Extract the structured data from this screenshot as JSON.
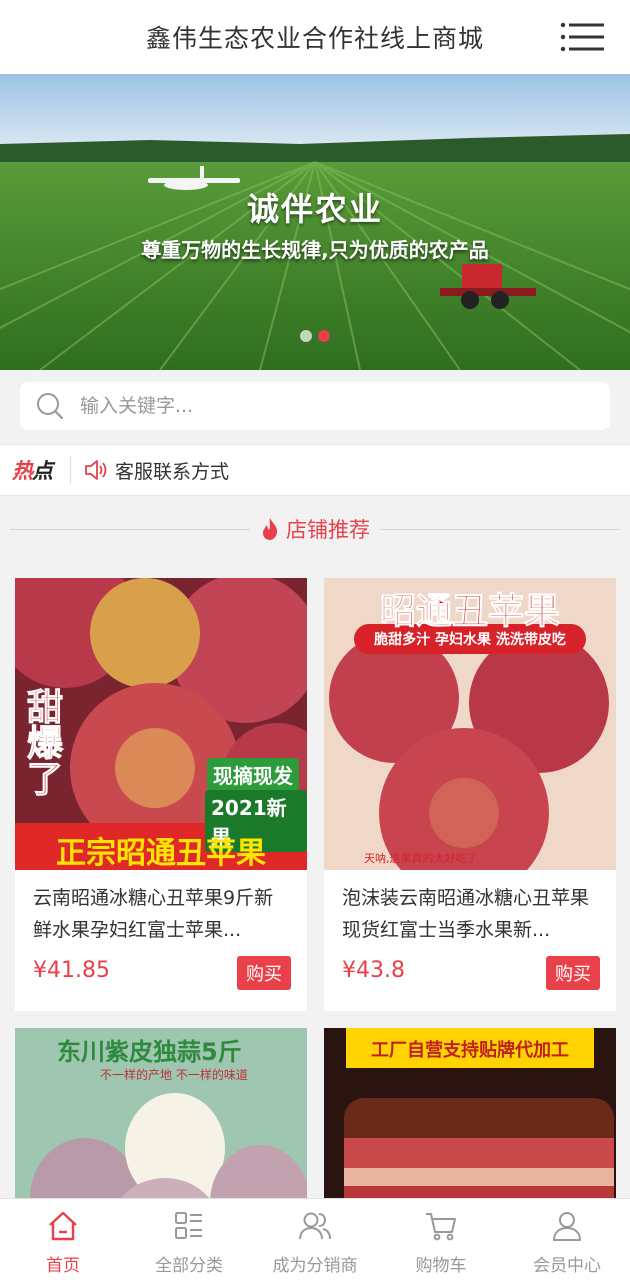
{
  "header": {
    "title": "鑫伟生态农业合作社线上商城",
    "menu_icon": "menu-icon"
  },
  "banner": {
    "headline": "诚伴农业",
    "subline": "尊重万物的生长规律,只为优质的农产品",
    "slide_count": 2,
    "active_slide": 2
  },
  "search": {
    "placeholder": "输入关键字...",
    "value": ""
  },
  "hot": {
    "badge_part1": "热",
    "badge_part2": "点",
    "notice": "客服联系方式",
    "notice_icon": "speaker-icon"
  },
  "section": {
    "title": "店铺推荐",
    "icon": "flame-icon"
  },
  "products": [
    {
      "title": "云南昭通冰糖心丑苹果9斤新鲜水果孕妇红富士苹果...",
      "price": "¥41.85",
      "buy_label": "购买",
      "image": {
        "side_text": "甜爆了",
        "tag1": "现摘现发",
        "tag2": "2021新果",
        "banner": "正宗昭通丑苹果"
      }
    },
    {
      "title": "泡沫装云南昭通冰糖心丑苹果现货红富士当季水果新...",
      "price": "¥43.8",
      "buy_label": "购买",
      "image": {
        "headline": "昭通丑苹果",
        "ribbon": "脆甜多汁 孕妇水果 洗洗带皮吃",
        "footer": "天呐,这果真的太好吃了"
      }
    },
    {
      "image": {
        "headline": "东川紫皮独蒜5斤",
        "sub": "不一样的产地 不一样的味道"
      }
    },
    {
      "image": {
        "headline": "工厂自营支持贴牌代加工"
      }
    }
  ],
  "tabbar": {
    "items": [
      {
        "label": "首页",
        "icon": "home-icon",
        "active": true
      },
      {
        "label": "全部分类",
        "icon": "grid-list-icon",
        "active": false
      },
      {
        "label": "成为分销商",
        "icon": "users-icon",
        "active": false
      },
      {
        "label": "购物车",
        "icon": "cart-icon",
        "active": false
      },
      {
        "label": "会员中心",
        "icon": "user-icon",
        "active": false
      }
    ]
  },
  "colors": {
    "accent": "#e8414a",
    "background": "#f2f2f2"
  }
}
